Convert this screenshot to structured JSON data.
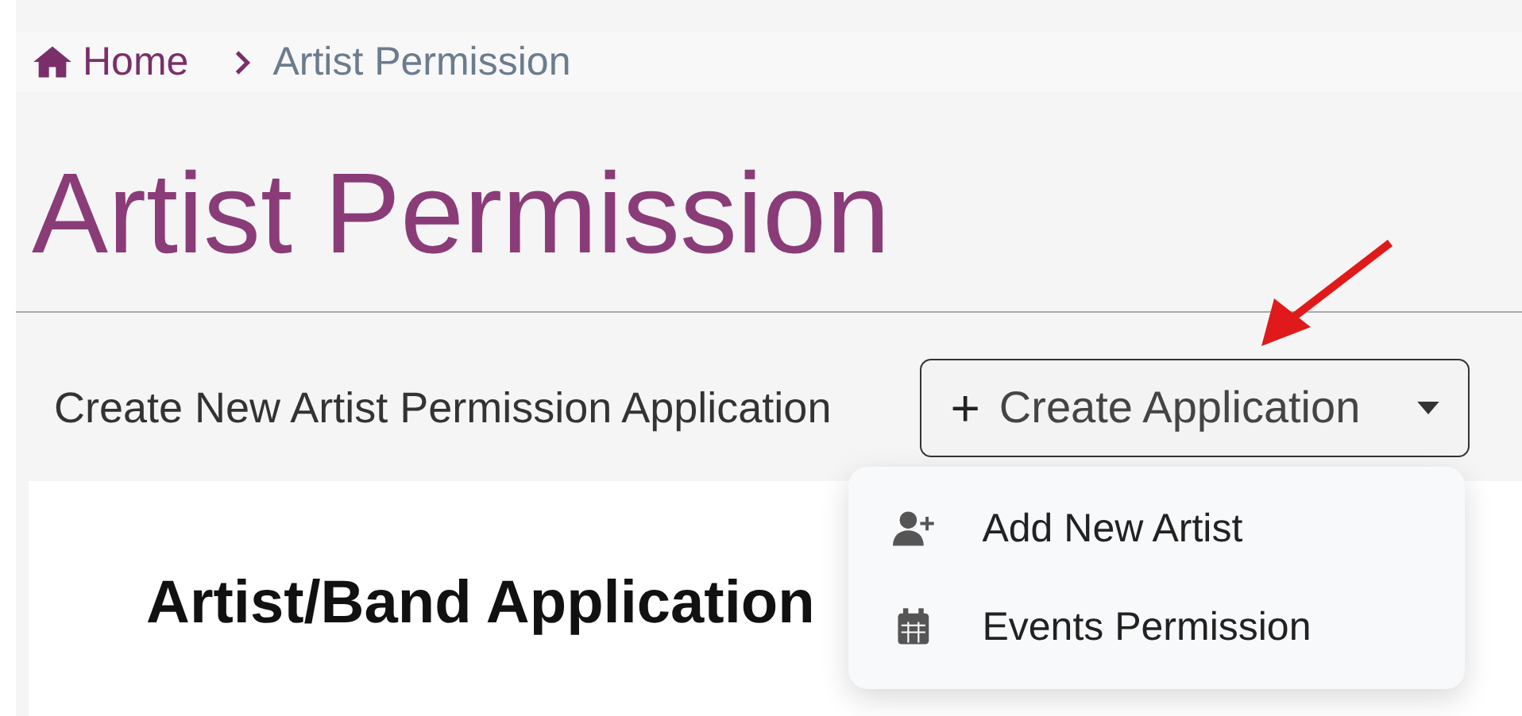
{
  "breadcrumb": [
    {
      "label": "Home",
      "kind": "home"
    },
    {
      "label": "Artist Permission",
      "kind": "current"
    }
  ],
  "page_title": "Artist Permission",
  "create_row": {
    "label": "Create New Artist Permission Application",
    "button": {
      "plus": "+",
      "label": "Create Application",
      "expanded": true
    }
  },
  "menu": [
    {
      "label": "Add New Artist",
      "kind": "add-person"
    },
    {
      "label": "Events Permission",
      "kind": "calendar"
    }
  ],
  "card": {
    "heading": "Artist/Band Application"
  }
}
